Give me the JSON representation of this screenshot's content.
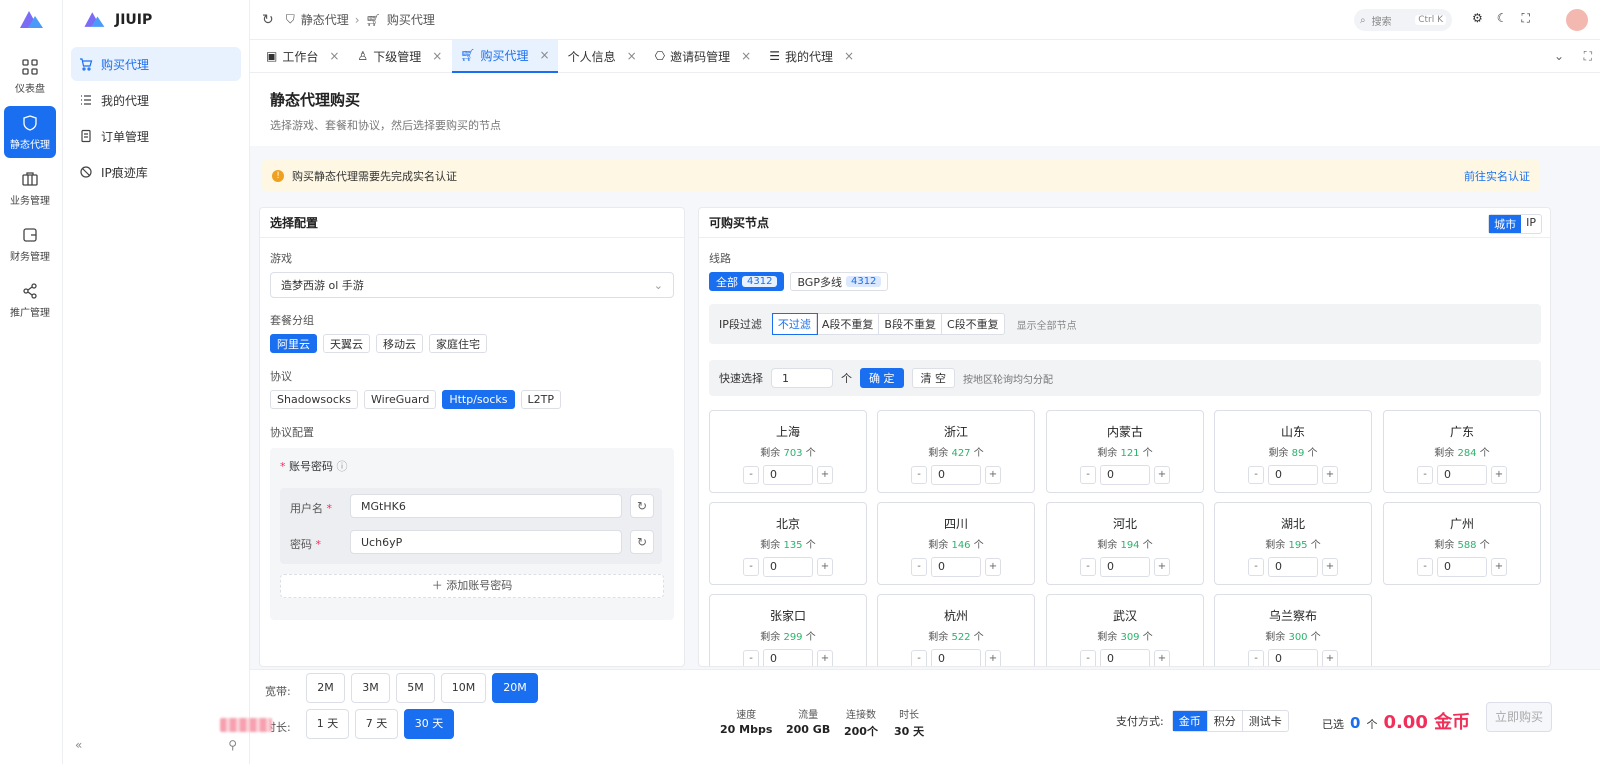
{
  "app": {
    "name": "JIUIP"
  },
  "rail": [
    {
      "label": "仪表盘",
      "icon": "grid-icon"
    },
    {
      "label": "静态代理",
      "icon": "shield-icon"
    },
    {
      "label": "业务管理",
      "icon": "briefcase-icon"
    },
    {
      "label": "财务管理",
      "icon": "wallet-icon"
    },
    {
      "label": "推广管理",
      "icon": "share-icon"
    }
  ],
  "sidebar": [
    {
      "label": "购买代理",
      "icon": "cart-icon"
    },
    {
      "label": "我的代理",
      "icon": "list-icon"
    },
    {
      "label": "订单管理",
      "icon": "document-icon"
    },
    {
      "label": "IP痕迹库",
      "icon": "ban-icon"
    }
  ],
  "breadcrumb": [
    "静态代理",
    "购买代理"
  ],
  "search": {
    "label": "搜索",
    "shortcut": "Ctrl K"
  },
  "tabs": [
    "工作台",
    "下级管理",
    "购买代理",
    "个人信息",
    "邀请码管理",
    "我的代理"
  ],
  "page": {
    "title": "静态代理购买",
    "subtitle": "选择游戏、套餐和协议，然后选择要购买的节点"
  },
  "alert": {
    "text": "购买静态代理需要先完成实名认证",
    "link": "前往实名认证"
  },
  "config": {
    "title": "选择配置",
    "game_label": "游戏",
    "game_value": "造梦西游 ol 手游",
    "package_label": "套餐分组",
    "packages": [
      "阿里云",
      "天翼云",
      "移动云",
      "家庭住宅"
    ],
    "protocol_label": "协议",
    "protocols": [
      "Shadowsocks",
      "WireGuard",
      "Http/socks",
      "L2TP"
    ],
    "protocol_config_label": "协议配置",
    "account_label": "账号密码",
    "username_label": "用户名",
    "username_value": "MGtHK6",
    "password_label": "密码",
    "password_value": "Uch6yP",
    "add_account": "添加账号密码"
  },
  "nodes": {
    "title": "可购买节点",
    "view_toggle": [
      "城市",
      "IP"
    ],
    "route_label": "线路",
    "routes": [
      {
        "label": "全部",
        "count": "4312"
      },
      {
        "label": "BGP多线",
        "count": "4312"
      }
    ],
    "ipfilter_label": "IP段过滤",
    "ipfilters": [
      "不过滤",
      "A段不重复",
      "B段不重复",
      "C段不重复"
    ],
    "show_all": "显示全部节点",
    "quick_label": "快速选择",
    "quick_value": "1",
    "quick_unit": "个",
    "confirm": "确 定",
    "clear": "清 空",
    "quick_hint": "按地区轮询均匀分配",
    "remain_prefix": "剩余",
    "unit": "个",
    "regions": [
      {
        "name": "上海",
        "remain": "703",
        "qty": "0"
      },
      {
        "name": "浙江",
        "remain": "427",
        "qty": "0"
      },
      {
        "name": "内蒙古",
        "remain": "121",
        "qty": "0"
      },
      {
        "name": "山东",
        "remain": "89",
        "qty": "0"
      },
      {
        "name": "广东",
        "remain": "284",
        "qty": "0"
      },
      {
        "name": "北京",
        "remain": "135",
        "qty": "0"
      },
      {
        "name": "四川",
        "remain": "146",
        "qty": "0"
      },
      {
        "name": "河北",
        "remain": "194",
        "qty": "0"
      },
      {
        "name": "湖北",
        "remain": "195",
        "qty": "0"
      },
      {
        "name": "广州",
        "remain": "588",
        "qty": "0"
      },
      {
        "name": "张家口",
        "remain": "299",
        "qty": "0"
      },
      {
        "name": "杭州",
        "remain": "522",
        "qty": "0"
      },
      {
        "name": "武汉",
        "remain": "309",
        "qty": "0"
      },
      {
        "name": "乌兰察布",
        "remain": "300",
        "qty": "0"
      }
    ]
  },
  "footer": {
    "bandwidth_label": "宽带:",
    "bandwidths": [
      "2M",
      "3M",
      "5M",
      "10M",
      "20M"
    ],
    "duration_label": "时长:",
    "durations": [
      "1 天",
      "7 天",
      "30 天"
    ],
    "stats": [
      {
        "label": "速度",
        "value": "20 Mbps"
      },
      {
        "label": "流量",
        "value": "200 GB"
      },
      {
        "label": "连接数",
        "value": "200个"
      },
      {
        "label": "时长",
        "value": "30 天"
      }
    ],
    "pay_label": "支付方式:",
    "pay_methods": [
      "金币",
      "积分",
      "测试卡"
    ],
    "selected_prefix": "已选",
    "selected_count": "0",
    "selected_unit": "个",
    "amount": "0.00 金币",
    "buy": "立即购买"
  },
  "colors": {
    "primary": "#1a6ff0",
    "remain": "#2bb36b",
    "amount": "#f0305a"
  }
}
